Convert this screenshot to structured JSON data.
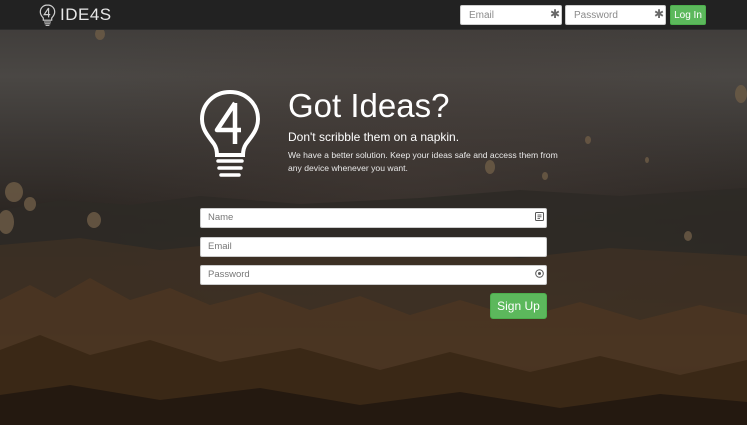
{
  "navbar": {
    "brand": "IDE4S",
    "email_placeholder": "Email",
    "password_placeholder": "Password",
    "login_label": "Log In"
  },
  "hero": {
    "title": "Got Ideas?",
    "subtitle": "Don't scribble them on a napkin.",
    "description": "We have a better solution. Keep your ideas safe and access them from any device whenever you want."
  },
  "signup": {
    "name_placeholder": "Name",
    "email_placeholder": "Email",
    "password_placeholder": "Password",
    "submit_label": "Sign Up"
  },
  "colors": {
    "navbar_bg": "#222222",
    "accent_green": "#5cb85c",
    "text_white": "#ffffff"
  },
  "icons": {
    "brand": "lightbulb-4-icon",
    "required": "asterisk-icon",
    "name_field": "contact-card-icon",
    "password_field": "key-icon"
  }
}
